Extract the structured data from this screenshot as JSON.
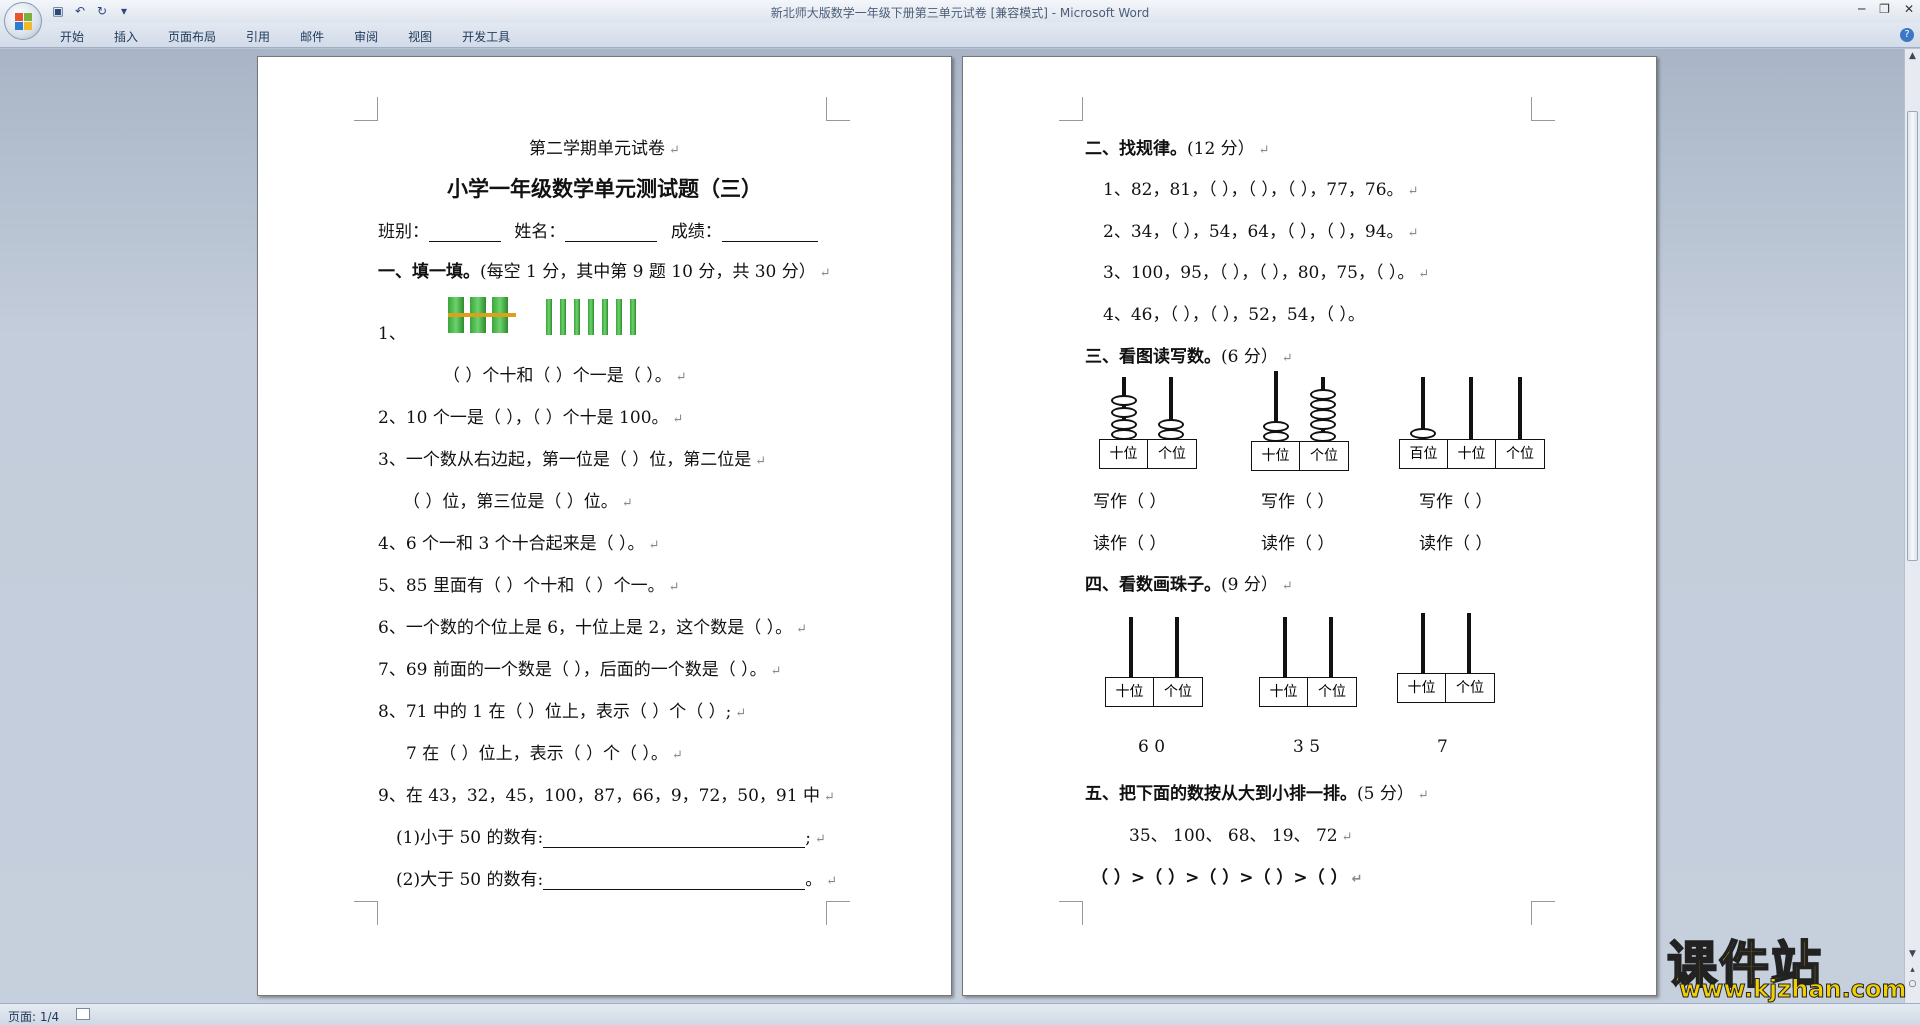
{
  "window": {
    "title": "新北师大版数学一年级下册第三单元试卷 [兼容模式] - Microsoft Word"
  },
  "ribbon": {
    "tabs": [
      "开始",
      "插入",
      "页面布局",
      "引用",
      "邮件",
      "审阅",
      "视图",
      "开发工具"
    ]
  },
  "status": {
    "page": "页面: 1/4"
  },
  "left": {
    "term": "第二学期单元试卷",
    "title": "小学一年级数学单元测试题（三）",
    "class_label": "班别：",
    "name_label": "姓名：",
    "score_label": "成绩：",
    "sec1": "一、填一填。",
    "sec1_note": "(每空 1 分，其中第 9 题 10 分，共 30 分）",
    "q1_num": "1、",
    "q1b": "（    ）个十和（    ）个一是（    ）。",
    "q2": "2、10 个一是（    ），（    ）个十是 100。",
    "q3a": "3、一个数从右边起，第一位是（    ）位，第二位是",
    "q3b": "（    ）位，第三位是（    ）位。",
    "q4": "4、6 个一和 3 个十合起来是（    ）。",
    "q5": "5、85 里面有（    ）个十和（    ）个一。",
    "q6": "6、一个数的个位上是 6，十位上是 2，这个数是（    ）。",
    "q7": "7、69 前面的一个数是（    ），后面的一个数是（    ）。",
    "q8a": "8、71 中的 1 在（    ）位上，表示（    ）个（    ）;",
    "q8b": "7 在（    ）位上，表示（    ）个（    ）。",
    "q9": "9、在 43，32，45，100，87，66，9，72，50，91 中",
    "q9a": "(1)小于 50 的数有:",
    "q9b": "(2)大于 50 的数有:"
  },
  "right": {
    "sec2": "二、找规律。",
    "sec2_note": "(12 分）",
    "r1": "1、82，81，（    ），（    ），（    ），77，76。",
    "r2": "2、34，（    ），54，64，（    ），（    ），94。",
    "r3": "3、100，95，（    ），（    ），80，75，（    ）。",
    "r4": "4、46，（    ），（    ），52，54，（    ）。",
    "sec3": "三、看图读写数。",
    "sec3_note": "(6 分）",
    "write": "写作（      ）",
    "read": "读作（      ）",
    "sec4": "四、看数画珠子。",
    "sec4_note": "(9 分）",
    "nums": [
      "6 0",
      "3 5",
      "7"
    ],
    "sec5": "五、把下面的数按从大到小排一排。",
    "sec5_note": "(5 分）",
    "list": "35、 100、 68、 19、 72",
    "order": "（    ）>（    ）>（    ）>（    ）>（    ）"
  },
  "abacus": {
    "tens": "十位",
    "ones": "个位",
    "hundreds": "百位"
  },
  "watermark": {
    "cn": "课件站",
    "url": "www.kjzhan.com"
  }
}
